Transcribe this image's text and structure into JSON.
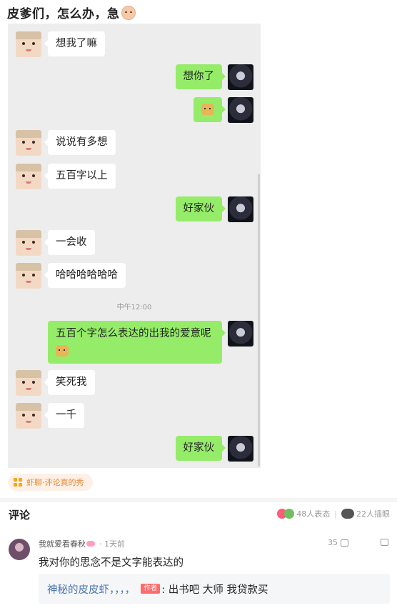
{
  "post": {
    "title": "皮爹们，怎么办，急"
  },
  "chat": {
    "messages": [
      {
        "side": "left",
        "text": "想我了嘛"
      },
      {
        "side": "right",
        "text": "想你了"
      },
      {
        "side": "right",
        "text": "",
        "emoji": "doge-emoji"
      },
      {
        "side": "left",
        "text": "说说有多想"
      },
      {
        "side": "left",
        "text": "五百字以上"
      },
      {
        "side": "right",
        "text": "好家伙"
      },
      {
        "side": "left",
        "text": "一会收"
      },
      {
        "side": "left",
        "text": "哈哈哈哈哈哈"
      },
      {
        "side": "right",
        "text": "五百个字怎么表达的出我的爱意呢",
        "emoji": "doge-emoji"
      },
      {
        "side": "left",
        "text": "笑死我"
      },
      {
        "side": "left",
        "text": "一千"
      },
      {
        "side": "right",
        "text": "好家伙"
      }
    ],
    "timestamp": "中午12:00"
  },
  "tag": {
    "label": "虾聊·评论真的秀"
  },
  "comments": {
    "title": "评论",
    "reactions_text": "48人表态",
    "insert_text": "22人插眼",
    "items": [
      {
        "username": "我就爱看春秋",
        "time": "· 1天前",
        "likes": "35",
        "text": "我对你的思念不是文字能表达的",
        "reply": {
          "name": "神秘的皮皮虾，，，，",
          "author_tag": "作者",
          "text": ": 出书吧 大师 我贷款买"
        }
      }
    ]
  },
  "colors": {
    "bubble_green": "#95ec69",
    "chat_bg": "#ededed",
    "link_blue": "#4a74b4",
    "tag_orange": "#e08b3c"
  }
}
